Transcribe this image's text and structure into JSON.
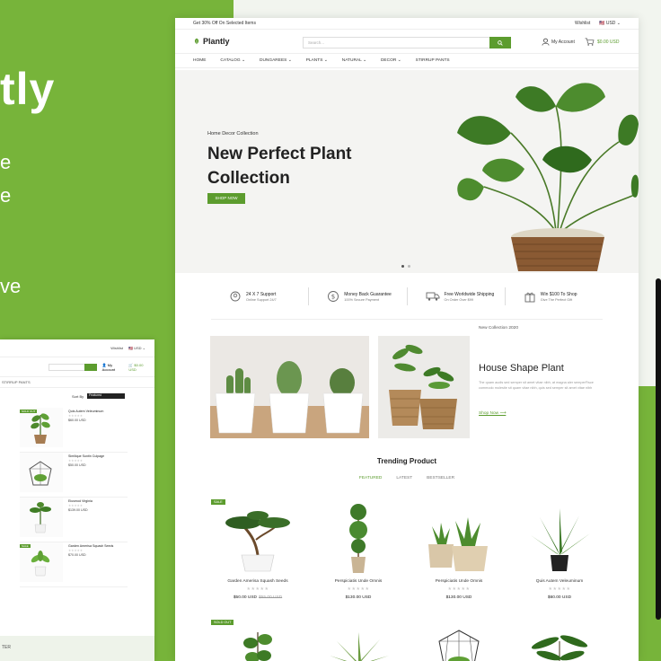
{
  "left_panel": {
    "brand": "tly",
    "line1": "e",
    "line2": "e",
    "line3": "ve"
  },
  "topbar": {
    "promo": "Get 30% Off On Selected Items",
    "wishlist": "Wishlist",
    "currency": "USD"
  },
  "header": {
    "logo": "Plantly",
    "search_placeholder": "Search...",
    "account": "My Account",
    "cart_total": "$0.00 USD"
  },
  "nav": {
    "items": [
      "HOME",
      "CATALOG ⌄",
      "DUNGAREES ⌄",
      "PLANTS ⌄",
      "NATURAL ⌄",
      "DECOR ⌄",
      "STIRRUP PANTS"
    ]
  },
  "hero": {
    "eyebrow": "Home Decor Collection",
    "title": "New Perfect Plant Collection",
    "button": "SHOP NOW"
  },
  "features": [
    {
      "title": "24 X 7 Support",
      "sub": "Online Support 24/7"
    },
    {
      "title": "Money Back Guarantee",
      "sub": "100% Secure Payment"
    },
    {
      "title": "Free Worldwide Shipping",
      "sub": "On Order Over $99"
    },
    {
      "title": "Win $100 To Shop",
      "sub": "Give The Perfect Gift"
    }
  ],
  "banner": {
    "eyebrow": "New Collection 2020",
    "title": "House Shape Plant",
    "text": "The quam audis sed semper sit amet vitae nibh, at magna aler semperFisce commodo molestie sit quam vitae nibh, quis sed semper sit amet vitae nibh",
    "link": "Shop Now ⟶"
  },
  "trending": {
    "title": "Trending Product",
    "tabs": [
      "FEATURED",
      "LATEST",
      "BESTSELLER"
    ],
    "stars": "★★★★★",
    "products": [
      {
        "name": "Garden Amerisa Squash Seeds",
        "price": "$50.00 USD",
        "old": "$55.00 USD",
        "badge": "SALE"
      },
      {
        "name": "Perspiciatis Unde Omnis",
        "price": "$130.00 USD",
        "old": "",
        "badge": ""
      },
      {
        "name": "Perspiciatis Unde Omnis",
        "price": "$130.00 USD",
        "old": "",
        "badge": ""
      },
      {
        "name": "Quis Autem Veleuminum",
        "price": "$60.00 USD",
        "old": "",
        "badge": ""
      }
    ],
    "row2_badge": "SOLD OUT"
  },
  "secondary": {
    "wishlist": "Wishlist",
    "currency": "USD",
    "account": "My Account",
    "cart": "$0.00 USD",
    "nav": "STIRRUP PANTS",
    "sort_label": "Sort By",
    "sort_value": "Featured",
    "items": [
      {
        "name": "Quis Autem Veleuminum",
        "price": "$60.00 USD",
        "badge": "SOLD OUT"
      },
      {
        "name": "Similique Suntin Culpage",
        "price": "$50.00 USD",
        "badge": ""
      },
      {
        "name": "Eiusmod Virginia",
        "price": "$139.00 USD",
        "badge": ""
      },
      {
        "name": "Garden Amerisa Squash Seeds",
        "price": "$70.00 USD",
        "badge": "SALE"
      }
    ],
    "footer": "TER"
  }
}
